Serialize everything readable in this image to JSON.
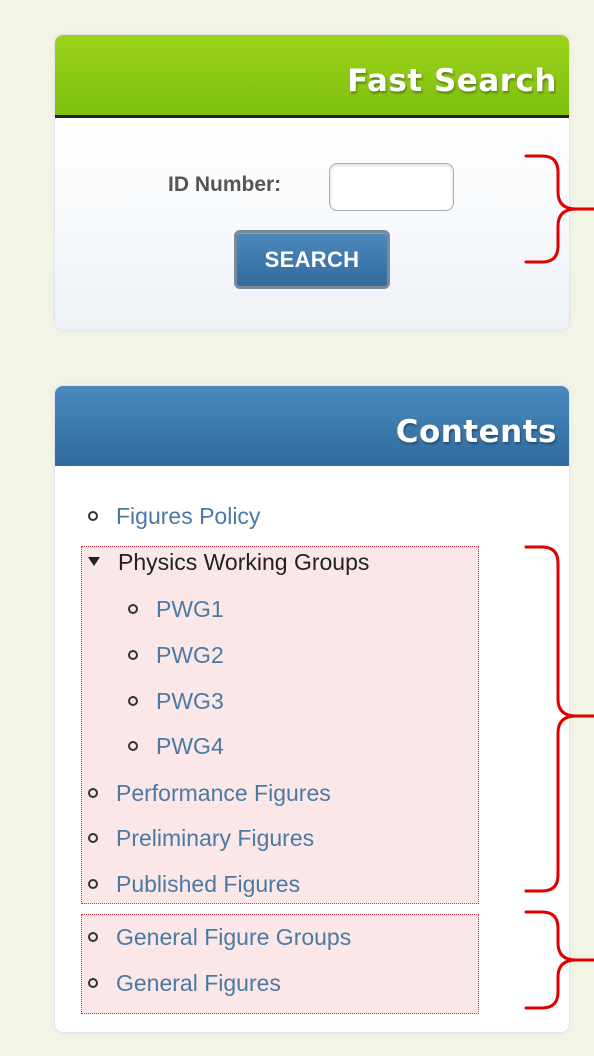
{
  "fast_search": {
    "title": "Fast Search",
    "id_label": "ID Number:",
    "id_value": "",
    "search_button_label": "SEARCH"
  },
  "contents": {
    "title": "Contents",
    "items": [
      {
        "label": "Figures Policy"
      },
      {
        "label": "Physics Working Groups"
      },
      {
        "label": "PWG1"
      },
      {
        "label": "PWG2"
      },
      {
        "label": "PWG3"
      },
      {
        "label": "PWG4"
      },
      {
        "label": "Performance Figures"
      },
      {
        "label": "Preliminary Figures"
      },
      {
        "label": "Published Figures"
      },
      {
        "label": "General Figure Groups"
      },
      {
        "label": "General Figures"
      }
    ]
  },
  "colors": {
    "background": "#f2f4e6",
    "fast_search_header": "#8bc616",
    "contents_header": "#3f7bae",
    "link_text": "#4b79a4",
    "highlight_fill": "#fbe7e7",
    "annotation_red": "#e00000"
  }
}
